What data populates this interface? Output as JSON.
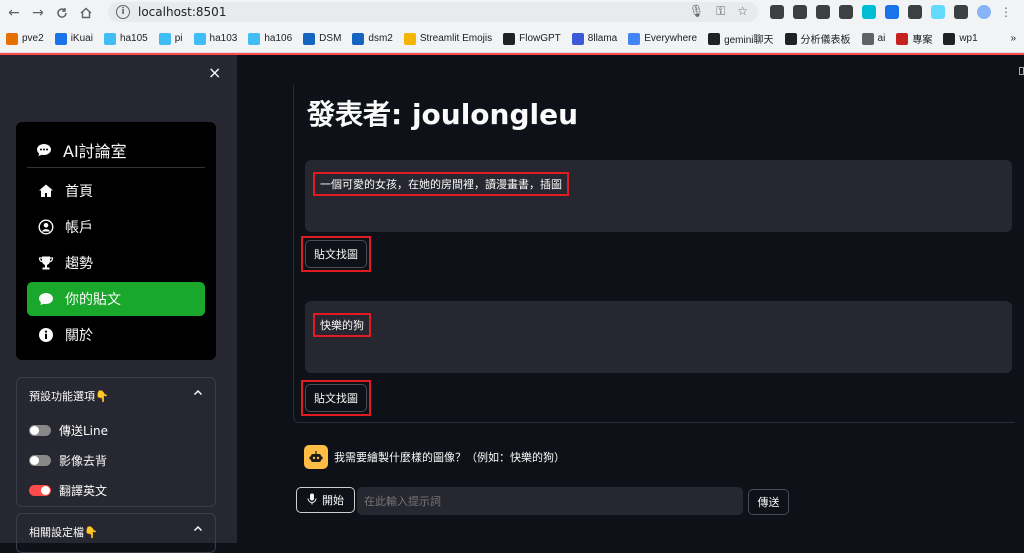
{
  "browser": {
    "url": "localhost:8501",
    "bookmarks": [
      {
        "label": "pve2",
        "color": "#e57000"
      },
      {
        "label": "iKuai",
        "color": "#1a73e8"
      },
      {
        "label": "ha105",
        "color": "#41bdf5"
      },
      {
        "label": "pi",
        "color": "#41bdf5"
      },
      {
        "label": "ha103",
        "color": "#41bdf5"
      },
      {
        "label": "ha106",
        "color": "#41bdf5"
      },
      {
        "label": "DSM",
        "color": "#1565c0"
      },
      {
        "label": "dsm2",
        "color": "#1565c0"
      },
      {
        "label": "Streamlit Emojis",
        "color": "#f4b400"
      },
      {
        "label": "FlowGPT",
        "color": "#202124"
      },
      {
        "label": "8llama",
        "color": "#3c5ad8"
      },
      {
        "label": "Everywhere",
        "color": "#4285f4"
      },
      {
        "label": "gemini聊天",
        "color": "#202124"
      },
      {
        "label": "分析儀表板",
        "color": "#202124"
      },
      {
        "label": "ai",
        "color": "#5f6368"
      },
      {
        "label": "專案",
        "color": "#c5221f"
      },
      {
        "label": "wp1",
        "color": "#202124"
      }
    ],
    "more": "»"
  },
  "sidebar": {
    "close": "×",
    "menu_title": "AI討論室",
    "items": [
      {
        "label": "首頁",
        "icon": "house-icon"
      },
      {
        "label": "帳戶",
        "icon": "person-circle-icon"
      },
      {
        "label": "趨勢",
        "icon": "trophy-icon"
      },
      {
        "label": "你的貼文",
        "icon": "chat-icon",
        "active": true
      },
      {
        "label": "關於",
        "icon": "info-icon"
      }
    ],
    "expander1": {
      "title": "預設功能選項👇",
      "toggles": [
        {
          "label": "傳送Line",
          "on": false
        },
        {
          "label": "影像去背",
          "on": false
        },
        {
          "label": "翻譯英文",
          "on": true
        }
      ]
    },
    "expander2": {
      "title": "相關設定檔👇"
    }
  },
  "main": {
    "title": "發表者: joulongleu",
    "posts": [
      {
        "text": "一個可愛的女孩，在她的房間裡，讀漫畫書，插圖",
        "button": "貼文找圖"
      },
      {
        "text": "快樂的狗",
        "button": "貼文找圖"
      }
    ],
    "chat_message": "我需要繪製什麼樣的圖像？（例如：快樂的狗）",
    "start_button": "開始",
    "prompt_placeholder": "在此輸入提示詞",
    "send_button": "傳送"
  }
}
